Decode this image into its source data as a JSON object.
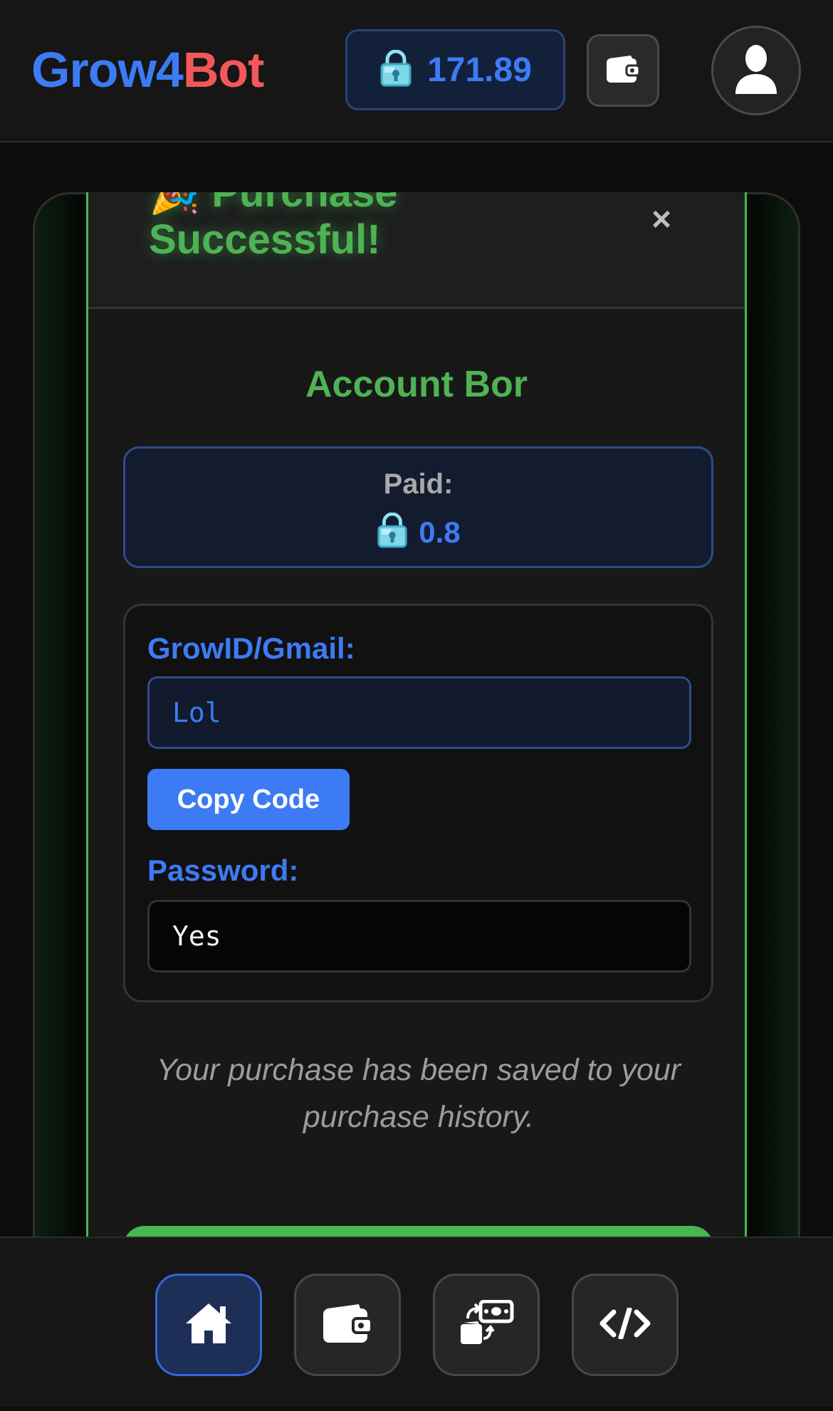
{
  "header": {
    "brand_part1": "Grow4",
    "brand_part2": "Bot",
    "balance": "171.89",
    "icons": {
      "currency": "diamond-lock-icon",
      "wallet": "wallet-icon",
      "profile": "user-icon"
    }
  },
  "modal": {
    "title_line1": "🎉 Purchase",
    "title_line2": "Successful!",
    "close_label": "×",
    "product_name": "Account Bor",
    "paid_label": "Paid:",
    "paid_amount": "0.8",
    "growid_label": "GrowID/Gmail:",
    "growid_value": "Lol",
    "copy_button": "Copy Code",
    "password_label": "Password:",
    "password_value": "Yes",
    "saved_note": "Your purchase has been saved to your purchase history."
  },
  "bottom_nav": {
    "items": [
      {
        "name": "home",
        "icon": "home-icon",
        "active": true
      },
      {
        "name": "wallet",
        "icon": "wallet-icon",
        "active": false
      },
      {
        "name": "exchange",
        "icon": "exchange-icon",
        "active": false
      },
      {
        "name": "developer",
        "icon": "code-icon",
        "active": false
      }
    ]
  },
  "colors": {
    "accent_blue": "#3d7bf5",
    "brand_red": "#f2585a",
    "success_green": "#4fb254",
    "background": "#0d0d0d"
  }
}
